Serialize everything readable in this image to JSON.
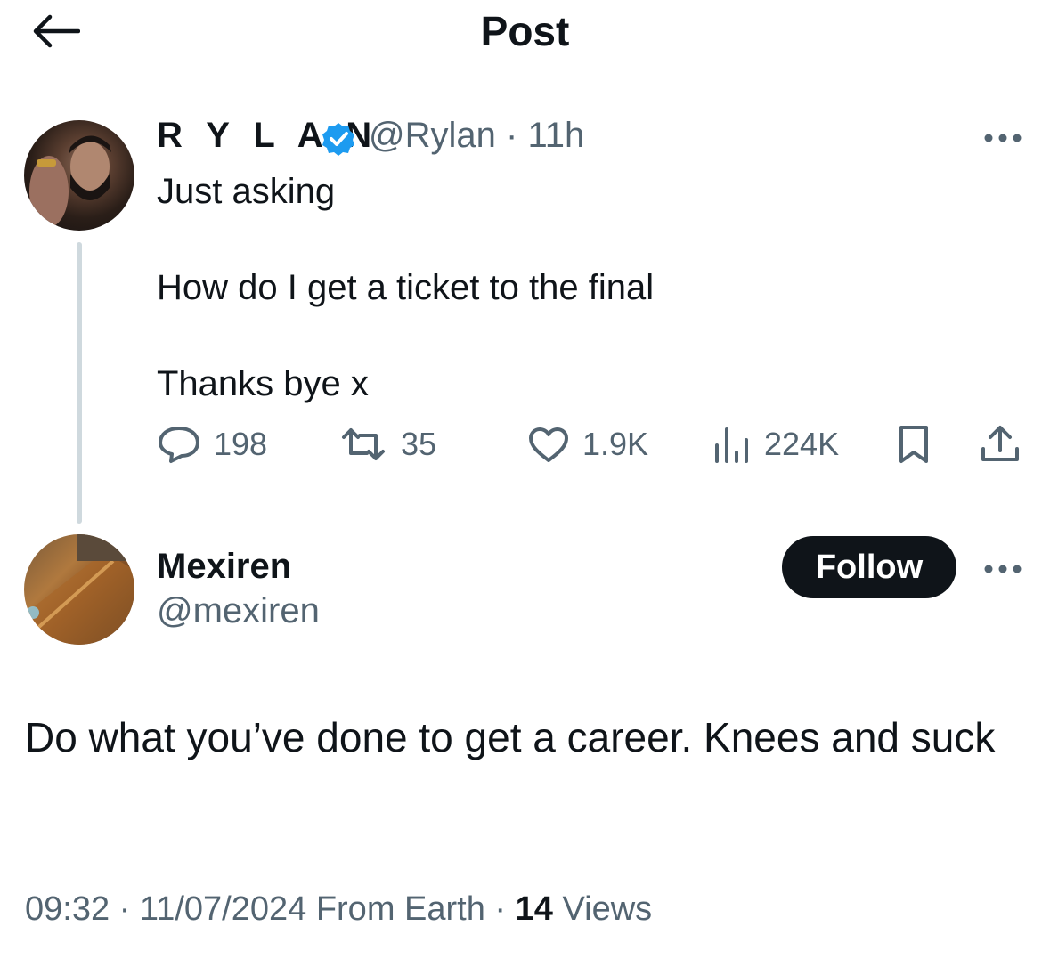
{
  "header": {
    "title": "Post",
    "back_icon": "arrow-left-icon"
  },
  "original_post": {
    "author_name": "R Y L A N",
    "verified": true,
    "handle": "@Rylan",
    "separator": "·",
    "time": "11h",
    "text": "Just asking\n\nHow do I get a ticket to the final\n\nThanks bye x",
    "stats": {
      "replies": "198",
      "reposts": "35",
      "likes": "1.9K",
      "views": "224K"
    }
  },
  "reply": {
    "author_name": "Mexiren",
    "handle": "@mexiren",
    "follow_label": "Follow",
    "text": "Do what you’ve done to get a career.  Knees and suck",
    "time": "09:32",
    "date": "11/07/2024",
    "source": "From Earth",
    "views_count": "14",
    "views_label": "Views"
  },
  "colors": {
    "text": "#0f1419",
    "secondary": "#536471",
    "verified": "#1d9bf0",
    "thread_line": "#cfd9de"
  }
}
